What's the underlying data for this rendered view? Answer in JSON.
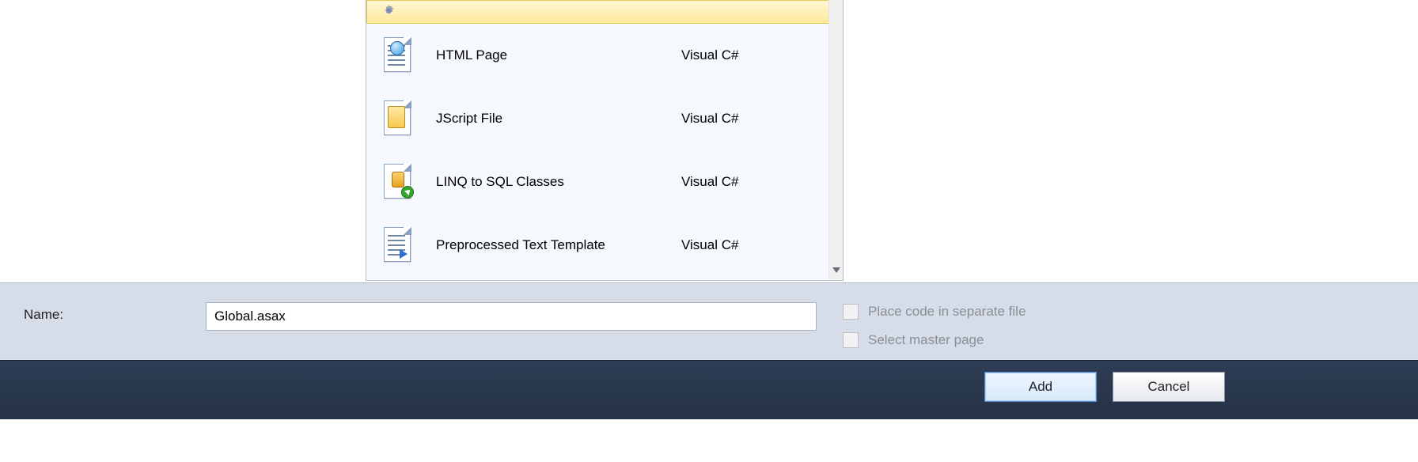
{
  "templates": {
    "items": [
      {
        "label": "",
        "lang": ""
      },
      {
        "label": "HTML Page",
        "lang": "Visual C#"
      },
      {
        "label": "JScript File",
        "lang": "Visual C#"
      },
      {
        "label": "LINQ to SQL Classes",
        "lang": "Visual C#"
      },
      {
        "label": "Preprocessed Text Template",
        "lang": "Visual C#"
      }
    ]
  },
  "name_field": {
    "label": "Name:",
    "value": "Global.asax"
  },
  "options": {
    "place_code": "Place code in separate file",
    "select_master": "Select master page"
  },
  "buttons": {
    "add": "Add",
    "cancel": "Cancel"
  }
}
